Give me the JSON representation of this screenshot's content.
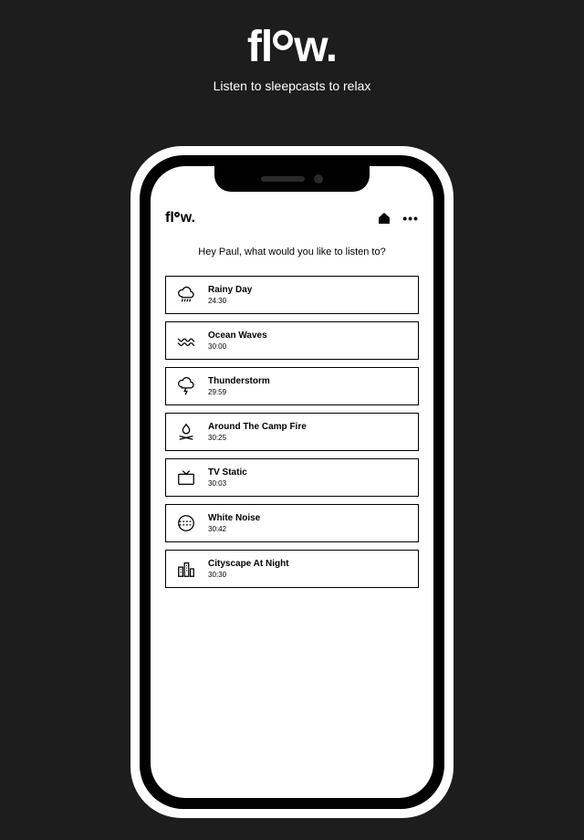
{
  "hero": {
    "logo_parts": {
      "pre": "fl",
      "post": "w."
    },
    "tagline": "Listen to sleepcasts to relax"
  },
  "app": {
    "logo_parts": {
      "pre": "fl",
      "post": "w."
    },
    "greeting": "Hey Paul, what would you like to listen to?",
    "items": [
      {
        "icon": "cloud-rain-icon",
        "title": "Rainy Day",
        "duration": "24:30"
      },
      {
        "icon": "waves-icon",
        "title": "Ocean Waves",
        "duration": "30:00"
      },
      {
        "icon": "thunder-icon",
        "title": "Thunderstorm",
        "duration": "29:59"
      },
      {
        "icon": "campfire-icon",
        "title": "Around The Camp Fire",
        "duration": "30:25"
      },
      {
        "icon": "tv-icon",
        "title": "TV Static",
        "duration": "30:03"
      },
      {
        "icon": "white-noise-icon",
        "title": "White Noise",
        "duration": "30:42"
      },
      {
        "icon": "city-icon",
        "title": "Cityscape At Night",
        "duration": "30:30"
      }
    ]
  }
}
